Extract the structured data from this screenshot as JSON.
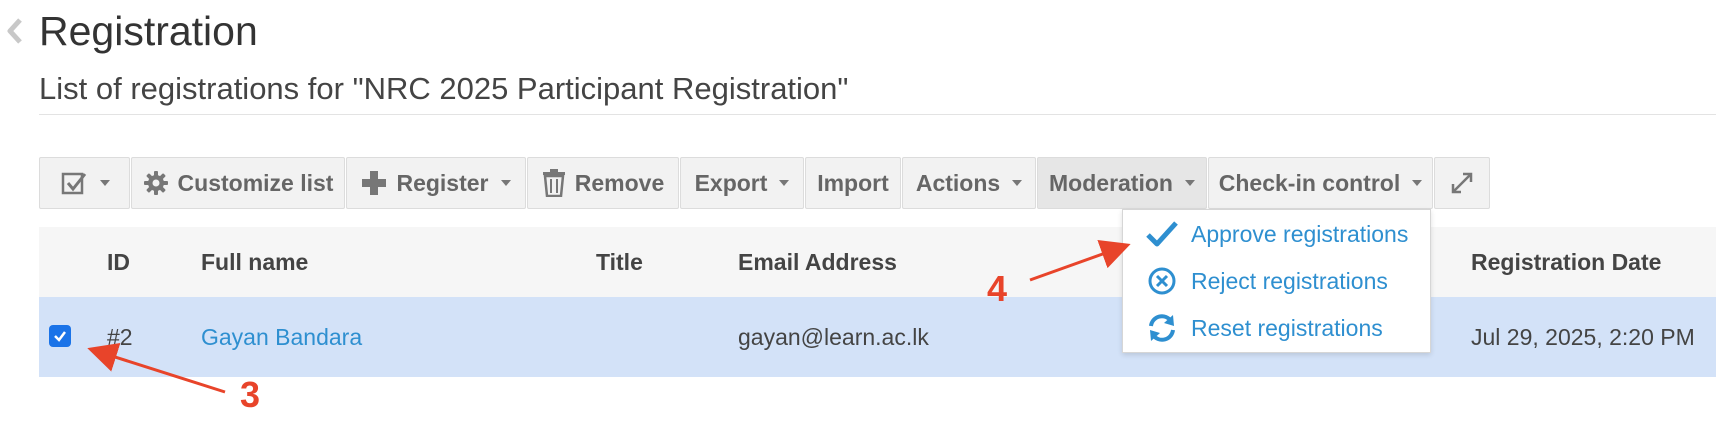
{
  "page": {
    "title": "Registration",
    "subtitle": "List of registrations for \"NRC 2025 Participant Registration\""
  },
  "toolbar": {
    "customize_label": "Customize list",
    "register_label": "Register",
    "remove_label": "Remove",
    "export_label": "Export",
    "import_label": "Import",
    "actions_label": "Actions",
    "moderation_label": "Moderation",
    "checkin_label": "Check-in control"
  },
  "table": {
    "headers": [
      "ID",
      "Full name",
      "Title",
      "Email Address",
      "Registration Date"
    ],
    "rows": [
      {
        "selected": true,
        "id": "#2",
        "full_name": "Gayan Bandara",
        "title": "",
        "email": "gayan@learn.ac.lk",
        "registration_date": "Jul 29, 2025, 2:20 PM"
      }
    ]
  },
  "moderation_menu": {
    "items": [
      {
        "label": "Approve registrations",
        "icon": "check-icon"
      },
      {
        "label": "Reject registrations",
        "icon": "circle-x-icon"
      },
      {
        "label": "Reset registrations",
        "icon": "refresh-icon"
      }
    ]
  },
  "annotations": {
    "step3_label": "3",
    "step4_label": "4",
    "arrow_color": "#e8442a"
  },
  "colors": {
    "accent_link": "#2e8fd0",
    "selected_row": "#d3e2f8",
    "checkbox": "#1a73e8"
  }
}
